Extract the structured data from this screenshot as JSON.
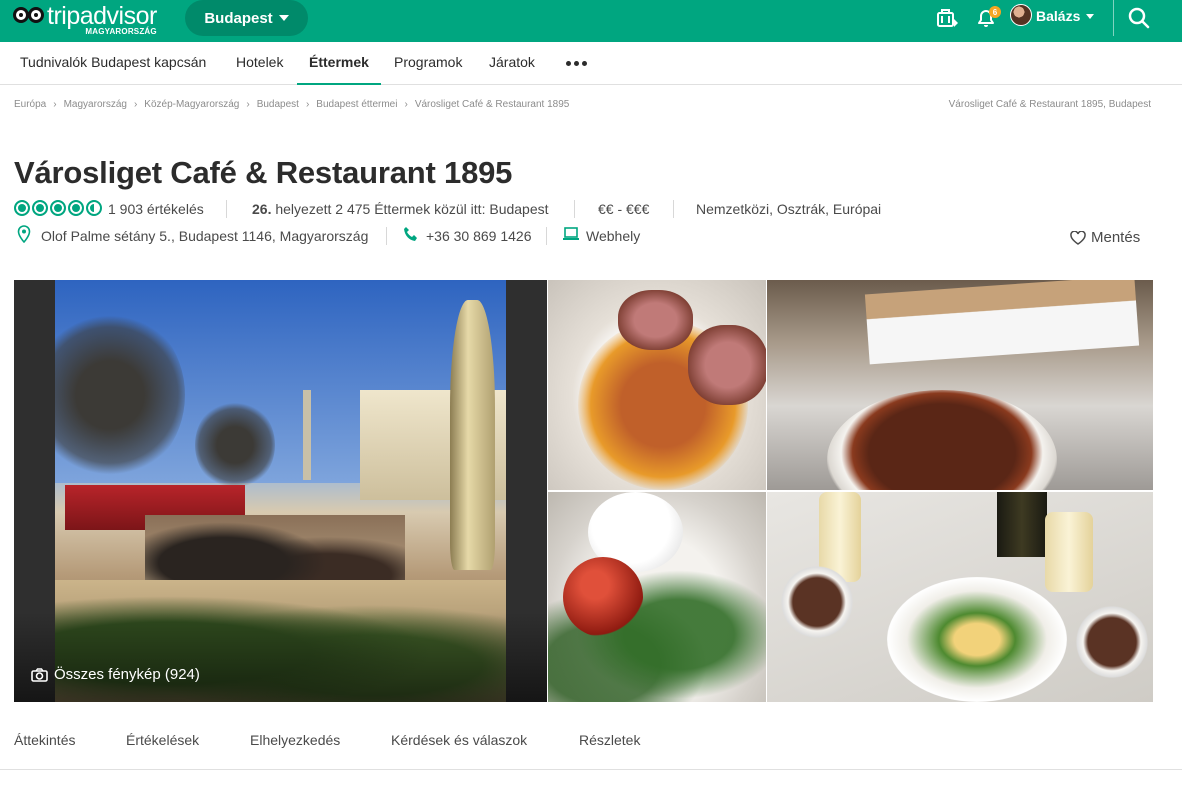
{
  "header": {
    "logo_brand": "tripadvisor",
    "logo_country": "MAGYARORSZÁG",
    "city": "Budapest",
    "notification_count": "6",
    "user_name": "Balázs",
    "brand_color": "#00a680"
  },
  "nav": {
    "items": [
      {
        "label": "Tudnivalók Budapest kapcsán",
        "active": false
      },
      {
        "label": "Hotelek",
        "active": false
      },
      {
        "label": "Éttermek",
        "active": true
      },
      {
        "label": "Programok",
        "active": false
      },
      {
        "label": "Járatok",
        "active": false
      }
    ],
    "more_icon": "more-dots-icon"
  },
  "breadcrumbs": {
    "items": [
      "Európa",
      "Magyarország",
      "Közép-Magyarország",
      "Budapest",
      "Budapest éttermei",
      "Városliget Café & Restaurant 1895"
    ],
    "right": "Városliget Café & Restaurant 1895, Budapest"
  },
  "restaurant": {
    "name": "Városliget Café & Restaurant 1895",
    "rating": 4.5,
    "reviews": "1 903 értékelés",
    "rank_number": "26.",
    "rank_text": " helyezett 2 475 Éttermek közül itt: Budapest",
    "price": "€€ - €€€",
    "cuisines": "Nemzetközi, Osztrák, Európai",
    "address": "Olof Palme sétány 5., Budapest 1146, Magyarország",
    "phone": "+36 30 869 1426",
    "website": "Webhely",
    "save": "Mentés"
  },
  "gallery": {
    "all_photos": "Összes fénykép (924)"
  },
  "subtabs": [
    "Áttekintés",
    "Értékelések",
    "Elhelyezkedés",
    "Kérdések és válaszok",
    "Részletek"
  ]
}
